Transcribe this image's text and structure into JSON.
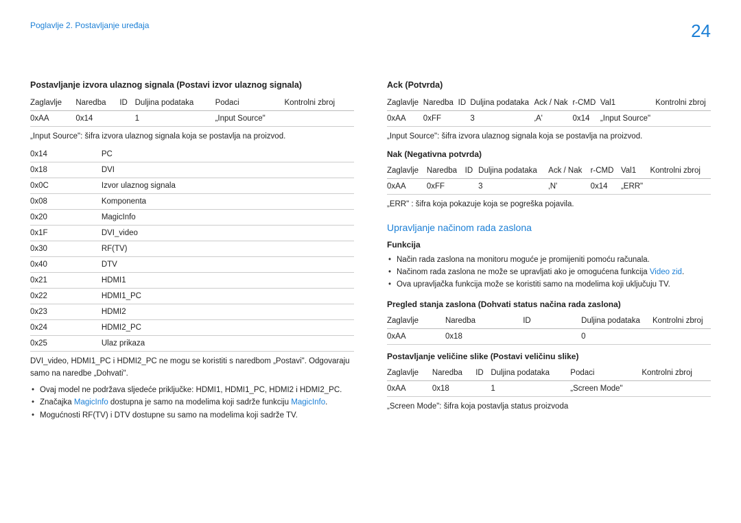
{
  "header": {
    "chapter": "Poglavlje 2. Postavljanje uređaja",
    "page": "24"
  },
  "left": {
    "title": "Postavljanje izvora ulaznog signala (Postavi izvor ulaznog signala)",
    "tbl1_hdr": [
      "Zaglavlje",
      "Naredba",
      "ID",
      "Duljina podataka",
      "Podaci",
      "Kontrolni zbroj"
    ],
    "tbl1_row": [
      "0xAA",
      "0x14",
      "",
      "1",
      "„Input Source\"",
      ""
    ],
    "note1": "„Input Source\": šifra izvora ulaznog signala koja se postavlja na proizvod.",
    "codes": [
      [
        "0x14",
        "PC"
      ],
      [
        "0x18",
        "DVI"
      ],
      [
        "0x0C",
        "Izvor ulaznog signala"
      ],
      [
        "0x08",
        "Komponenta"
      ],
      [
        "0x20",
        "MagicInfo"
      ],
      [
        "0x1F",
        "DVI_video"
      ],
      [
        "0x30",
        "RF(TV)"
      ],
      [
        "0x40",
        "DTV"
      ],
      [
        "0x21",
        "HDMI1"
      ],
      [
        "0x22",
        "HDMI1_PC"
      ],
      [
        "0x23",
        "HDMI2"
      ],
      [
        "0x24",
        "HDMI2_PC"
      ],
      [
        "0x25",
        "Ulaz prikaza"
      ]
    ],
    "note2": "DVI_video, HDMI1_PC i HDMI2_PC ne mogu se koristiti s naredbom „Postavi\". Odgovaraju samo na naredbe „Dohvati\".",
    "b1": "Ovaj model ne podržava sljedeće priključke: HDMI1, HDMI1_PC, HDMI2 i HDMI2_PC.",
    "b2a": "Značajka ",
    "b2link1": "MagicInfo",
    "b2b": " dostupna je samo na modelima koji sadrže funkciju ",
    "b2link2": "MagicInfo",
    "b2c": ".",
    "b3": "Mogućnosti RF(TV) i DTV dostupne su samo na modelima koji sadrže TV."
  },
  "right": {
    "ack_title": "Ack (Potvrda)",
    "ack_hdr": [
      "Zaglavlje",
      "Naredba",
      "ID",
      "Duljina podataka",
      "Ack / Nak",
      "r-CMD",
      "Val1",
      "Kontrolni zbroj"
    ],
    "ack_row": [
      "0xAA",
      "0xFF",
      "",
      "3",
      "‚A'",
      "0x14",
      "„Input Source\"",
      ""
    ],
    "ack_note": "„Input Source\": šifra izvora ulaznog signala koja se postavlja na proizvod.",
    "nak_title": "Nak (Negativna potvrda)",
    "nak_hdr": [
      "Zaglavlje",
      "Naredba",
      "ID",
      "Duljina podataka",
      "Ack / Nak",
      "r-CMD",
      "Val1",
      "Kontrolni zbroj"
    ],
    "nak_row": [
      "0xAA",
      "0xFF",
      "",
      "3",
      "‚N'",
      "0x14",
      "„ERR\"",
      ""
    ],
    "nak_note": "„ERR\" : šifra koja pokazuje koja se pogreška pojavila.",
    "section2": "Upravljanje načinom rada zaslona",
    "funkcija": "Funkcija",
    "f1": "Način rada zaslona na monitoru moguće je promijeniti pomoću računala.",
    "f2a": "Načinom rada zaslona ne može se upravljati ako je omogućena funkcija ",
    "f2link": "Video zid",
    "f2b": ".",
    "f3": "Ova upravljačka funkcija može se koristiti samo na modelima koji uključuju TV.",
    "view_title": "Pregled stanja zaslona (Dohvati status načina rada zaslona)",
    "view_hdr": [
      "Zaglavlje",
      "Naredba",
      "ID",
      "Duljina podataka",
      "Kontrolni zbroj"
    ],
    "view_row": [
      "0xAA",
      "0x18",
      "",
      "0",
      ""
    ],
    "set_title": "Postavljanje veličine slike (Postavi veličinu slike)",
    "set_hdr": [
      "Zaglavlje",
      "Naredba",
      "ID",
      "Duljina podataka",
      "Podaci",
      "Kontrolni zbroj"
    ],
    "set_row": [
      "0xAA",
      "0x18",
      "",
      "1",
      "„Screen Mode\"",
      ""
    ],
    "set_note": "„Screen Mode\": šifra koja postavlja status proizvoda"
  }
}
